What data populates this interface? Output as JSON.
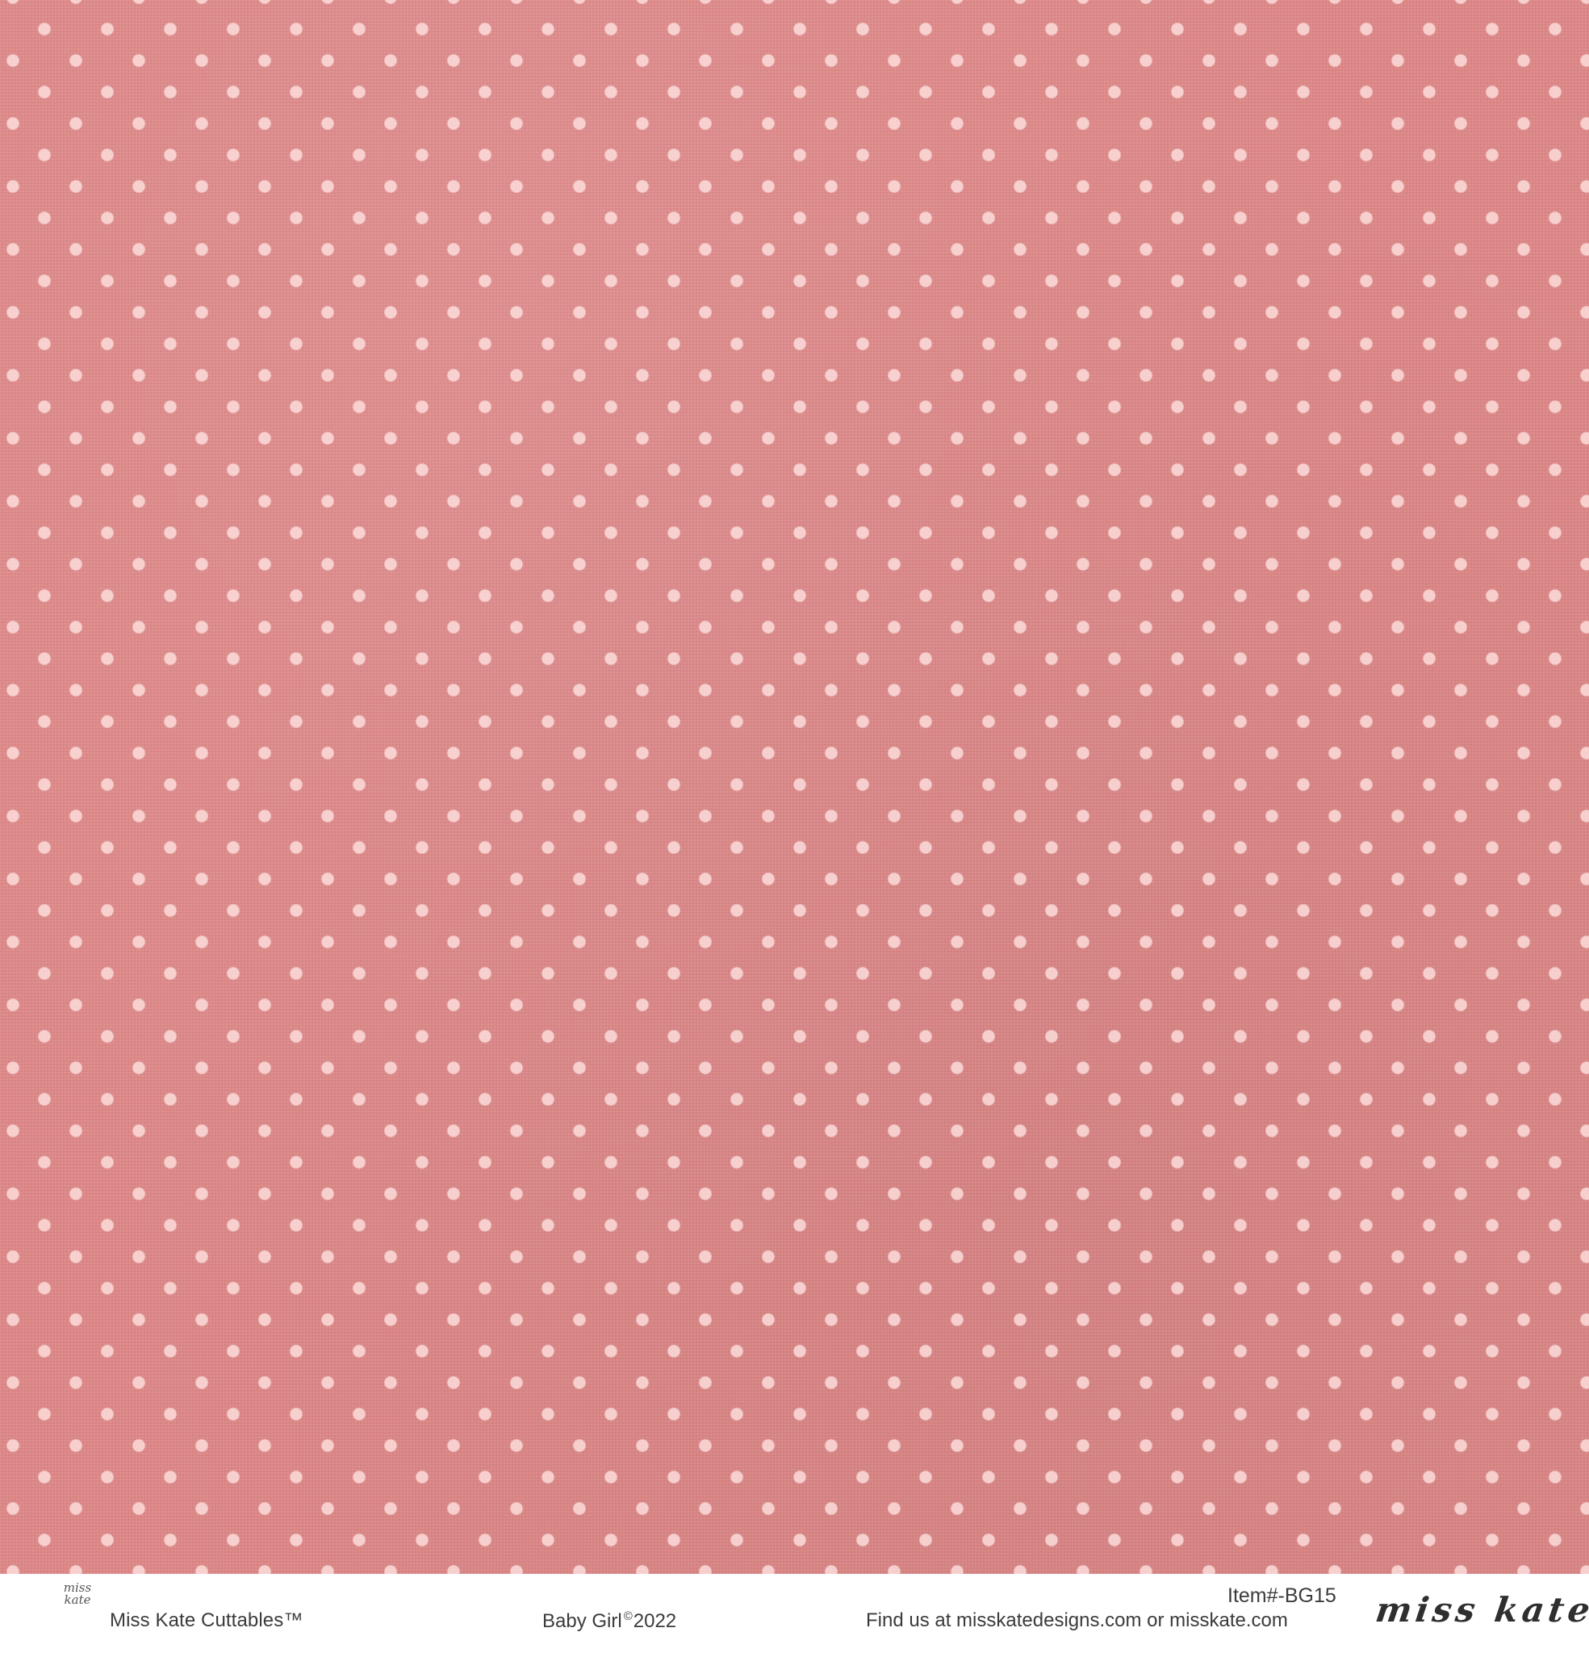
{
  "paper": {
    "background_color": "#df8787",
    "dot_color": "#ffe4e2",
    "pattern": "polka-dot"
  },
  "footer": {
    "logo_mark_line1": "miss",
    "logo_mark_line2": "kate",
    "left_brand": "Miss Kate Cuttables™",
    "collection_name": "Baby Girl",
    "copyright_symbol": "©",
    "year": "2022",
    "item_number": "Item#-BG15",
    "website_text": "Find us at misskatedesigns.com or misskate.com",
    "signature": "miss kate"
  }
}
